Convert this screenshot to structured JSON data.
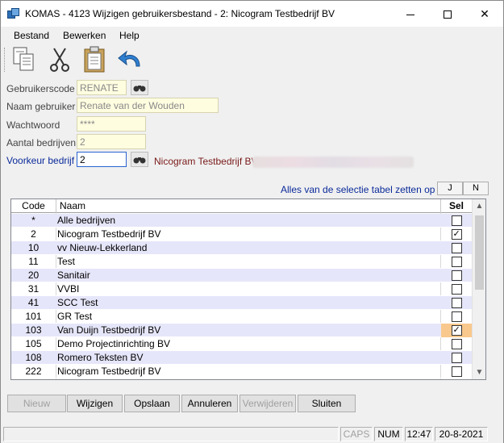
{
  "window": {
    "title": "KOMAS - 4123 Wijzigen gebruikersbestand - 2: Nicogram Testbedrijf BV",
    "minimize_glyph": "—",
    "maximize_glyph": "☐",
    "close_glyph": "✕"
  },
  "menu": [
    "Bestand",
    "Bewerken",
    "Help"
  ],
  "toolbar": {
    "icons": [
      "copy-icon",
      "cut-icon",
      "paste-icon",
      "undo-icon"
    ]
  },
  "form": {
    "gebruikerscode_label": "Gebruikerscode",
    "gebruikerscode_value": "RENATE",
    "naam_label": "Naam gebruiker",
    "naam_value": "Renate van der Wouden",
    "wachtwoord_label": "Wachtwoord",
    "wachtwoord_value": "****",
    "aantal_label": "Aantal bedrijven",
    "aantal_value": "2",
    "voorkeur_label": "Voorkeur bedrijf",
    "voorkeur_value": "2",
    "voorkeur_company": "Nicogram Testbedrijf BV"
  },
  "selection": {
    "caption": "Alles van de selectie tabel zetten op",
    "yes_label": "J",
    "no_label": "N"
  },
  "grid": {
    "columns": [
      "Code",
      "Naam",
      "Sel"
    ],
    "rows": [
      {
        "code": "*",
        "naam": "Alle bedrijven",
        "sel": false,
        "highlight": false
      },
      {
        "code": "2",
        "naam": "Nicogram Testbedrijf BV",
        "sel": true,
        "highlight": false
      },
      {
        "code": "10",
        "naam": "vv Nieuw-Lekkerland",
        "sel": false,
        "highlight": false
      },
      {
        "code": "11",
        "naam": "Test",
        "sel": false,
        "highlight": false
      },
      {
        "code": "20",
        "naam": "Sanitair",
        "sel": false,
        "highlight": false
      },
      {
        "code": "31",
        "naam": "VVBI",
        "sel": false,
        "highlight": false
      },
      {
        "code": "41",
        "naam": "SCC Test",
        "sel": false,
        "highlight": false
      },
      {
        "code": "101",
        "naam": "GR Test",
        "sel": false,
        "highlight": false
      },
      {
        "code": "103",
        "naam": "Van Duijn Testbedrijf BV",
        "sel": true,
        "highlight": true
      },
      {
        "code": "105",
        "naam": "Demo Projectinrichting  BV",
        "sel": false,
        "highlight": false
      },
      {
        "code": "108",
        "naam": "Romero Teksten BV",
        "sel": false,
        "highlight": false
      },
      {
        "code": "222",
        "naam": "Nicogram Testbedrijf BV",
        "sel": false,
        "highlight": false
      }
    ]
  },
  "buttons": {
    "nieuw": "Nieuw",
    "wijzigen": "Wijzigen",
    "opslaan": "Opslaan",
    "annuleren": "Annuleren",
    "verwijderen": "Verwijderen",
    "sluiten": "Sluiten"
  },
  "status": {
    "caps": "CAPS",
    "num": "NUM",
    "time": "12:47",
    "date": "20-8-2021"
  }
}
